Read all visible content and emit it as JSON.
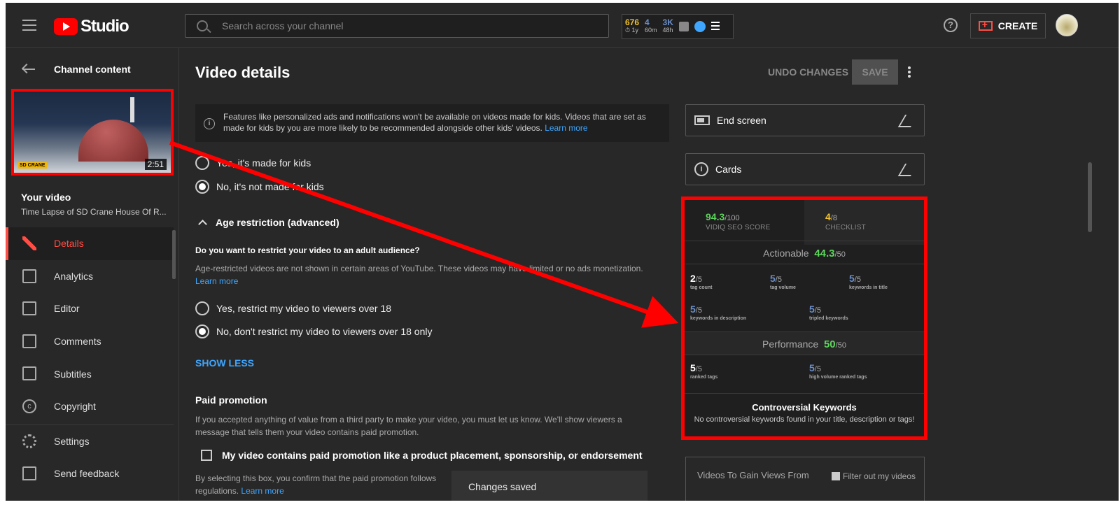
{
  "header": {
    "logo_text": "Studio",
    "search_placeholder": "Search across your channel",
    "stats": [
      {
        "value": "676",
        "sub": "⏱ 1y",
        "color": "#f1c232"
      },
      {
        "value": "4",
        "sub": "60m",
        "color": "#6a8ec8"
      },
      {
        "value": "3K",
        "sub": "48h",
        "color": "#6a8ec8"
      }
    ],
    "create_label": "CREATE"
  },
  "sidebar": {
    "title": "Channel content",
    "thumbnail_duration": "2:51",
    "thumbnail_badge": "SD CRANE",
    "your_video_label": "Your video",
    "video_name": "Time Lapse of SD Crane House Of R...",
    "nav": [
      {
        "label": "Details",
        "icon": "pencil-icon",
        "active": true
      },
      {
        "label": "Analytics",
        "icon": "analytics-icon"
      },
      {
        "label": "Editor",
        "icon": "editor-icon"
      },
      {
        "label": "Comments",
        "icon": "comments-icon"
      },
      {
        "label": "Subtitles",
        "icon": "subtitles-icon"
      },
      {
        "label": "Copyright",
        "icon": "copyright-icon"
      }
    ],
    "bottom_nav": [
      {
        "label": "Settings",
        "icon": "gear-icon"
      },
      {
        "label": "Send feedback",
        "icon": "feedback-icon"
      }
    ]
  },
  "main": {
    "title": "Video details",
    "undo_label": "UNDO CHANGES",
    "save_label": "SAVE",
    "info_text": "Features like personalized ads and notifications won't be available on videos made for kids. Videos that are set as made for kids by you are more likely to be recommended alongside other kids' videos.",
    "info_link": "Learn more",
    "kids_yes": "Yes, it's made for kids",
    "kids_no": "No, it's not made for kids",
    "age_heading": "Age restriction (advanced)",
    "age_question": "Do you want to restrict your video to an adult audience?",
    "age_desc": "Age-restricted videos are not shown in certain areas of YouTube. These videos may have limited or no ads monetization.",
    "age_link": "Learn more",
    "age_yes": "Yes, restrict my video to viewers over 18",
    "age_no": "No, don't restrict my video to viewers over 18 only",
    "show_less": "SHOW LESS",
    "paid_heading": "Paid promotion",
    "paid_desc": "If you accepted anything of value from a third party to make your video, you must let us know. We'll show viewers a message that tells them your video contains paid promotion.",
    "paid_checkbox": "My video contains paid promotion like a product placement, sponsorship, or endorsement",
    "paid_confirm": "By selecting this box, you confirm that the paid promotion follows",
    "paid_confirm_2": "regulations.",
    "paid_link": "Learn more",
    "toast": "Changes saved"
  },
  "right": {
    "end_screen": "End screen",
    "cards": "Cards",
    "seo": {
      "score_value": "94.3",
      "score_max": "/100",
      "score_label": "VIDIQ SEO SCORE",
      "checklist_value": "4",
      "checklist_max": "/8",
      "checklist_label": "CHECKLIST",
      "actionable_label": "Actionable",
      "actionable_value": "44.3",
      "actionable_max": "/50",
      "actionable_metrics": [
        {
          "value": "2",
          "max": "/5",
          "label": "tag count"
        },
        {
          "value": "5",
          "max": "/5",
          "label": "tag volume"
        },
        {
          "value": "5",
          "max": "/5",
          "label": "keywords in title"
        },
        {
          "value": "5",
          "max": "/5",
          "label": "keywords in description"
        },
        {
          "value": "5",
          "max": "/5",
          "label": "tripled keywords"
        }
      ],
      "performance_label": "Performance",
      "performance_value": "50",
      "performance_max": "/50",
      "performance_metrics": [
        {
          "value": "5",
          "max": "/5",
          "label": "ranked tags"
        },
        {
          "value": "5",
          "max": "/5",
          "label": "high volume ranked tags"
        }
      ],
      "controversial_title": "Controversial Keywords",
      "controversial_desc": "No controversial keywords found in your title, description or tags!"
    },
    "videos_gain_title": "Videos To Gain Views From",
    "filter_label": "Filter out my videos"
  },
  "annotation": {
    "color": "#ff0000"
  }
}
